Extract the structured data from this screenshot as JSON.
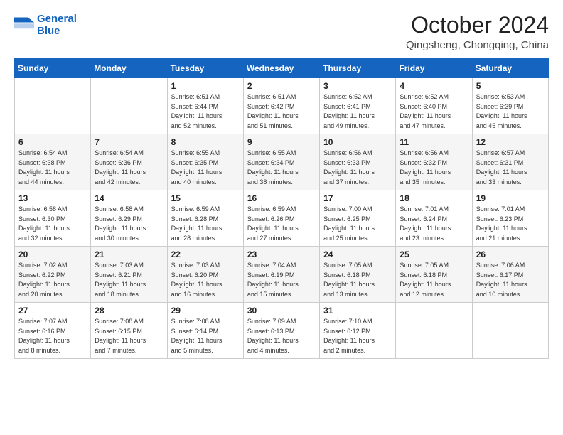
{
  "header": {
    "logo_line1": "General",
    "logo_line2": "Blue",
    "month": "October 2024",
    "location": "Qingsheng, Chongqing, China"
  },
  "weekdays": [
    "Sunday",
    "Monday",
    "Tuesday",
    "Wednesday",
    "Thursday",
    "Friday",
    "Saturday"
  ],
  "weeks": [
    [
      {
        "day": "",
        "info": ""
      },
      {
        "day": "",
        "info": ""
      },
      {
        "day": "1",
        "info": "Sunrise: 6:51 AM\nSunset: 6:44 PM\nDaylight: 11 hours\nand 52 minutes."
      },
      {
        "day": "2",
        "info": "Sunrise: 6:51 AM\nSunset: 6:42 PM\nDaylight: 11 hours\nand 51 minutes."
      },
      {
        "day": "3",
        "info": "Sunrise: 6:52 AM\nSunset: 6:41 PM\nDaylight: 11 hours\nand 49 minutes."
      },
      {
        "day": "4",
        "info": "Sunrise: 6:52 AM\nSunset: 6:40 PM\nDaylight: 11 hours\nand 47 minutes."
      },
      {
        "day": "5",
        "info": "Sunrise: 6:53 AM\nSunset: 6:39 PM\nDaylight: 11 hours\nand 45 minutes."
      }
    ],
    [
      {
        "day": "6",
        "info": "Sunrise: 6:54 AM\nSunset: 6:38 PM\nDaylight: 11 hours\nand 44 minutes."
      },
      {
        "day": "7",
        "info": "Sunrise: 6:54 AM\nSunset: 6:36 PM\nDaylight: 11 hours\nand 42 minutes."
      },
      {
        "day": "8",
        "info": "Sunrise: 6:55 AM\nSunset: 6:35 PM\nDaylight: 11 hours\nand 40 minutes."
      },
      {
        "day": "9",
        "info": "Sunrise: 6:55 AM\nSunset: 6:34 PM\nDaylight: 11 hours\nand 38 minutes."
      },
      {
        "day": "10",
        "info": "Sunrise: 6:56 AM\nSunset: 6:33 PM\nDaylight: 11 hours\nand 37 minutes."
      },
      {
        "day": "11",
        "info": "Sunrise: 6:56 AM\nSunset: 6:32 PM\nDaylight: 11 hours\nand 35 minutes."
      },
      {
        "day": "12",
        "info": "Sunrise: 6:57 AM\nSunset: 6:31 PM\nDaylight: 11 hours\nand 33 minutes."
      }
    ],
    [
      {
        "day": "13",
        "info": "Sunrise: 6:58 AM\nSunset: 6:30 PM\nDaylight: 11 hours\nand 32 minutes."
      },
      {
        "day": "14",
        "info": "Sunrise: 6:58 AM\nSunset: 6:29 PM\nDaylight: 11 hours\nand 30 minutes."
      },
      {
        "day": "15",
        "info": "Sunrise: 6:59 AM\nSunset: 6:28 PM\nDaylight: 11 hours\nand 28 minutes."
      },
      {
        "day": "16",
        "info": "Sunrise: 6:59 AM\nSunset: 6:26 PM\nDaylight: 11 hours\nand 27 minutes."
      },
      {
        "day": "17",
        "info": "Sunrise: 7:00 AM\nSunset: 6:25 PM\nDaylight: 11 hours\nand 25 minutes."
      },
      {
        "day": "18",
        "info": "Sunrise: 7:01 AM\nSunset: 6:24 PM\nDaylight: 11 hours\nand 23 minutes."
      },
      {
        "day": "19",
        "info": "Sunrise: 7:01 AM\nSunset: 6:23 PM\nDaylight: 11 hours\nand 21 minutes."
      }
    ],
    [
      {
        "day": "20",
        "info": "Sunrise: 7:02 AM\nSunset: 6:22 PM\nDaylight: 11 hours\nand 20 minutes."
      },
      {
        "day": "21",
        "info": "Sunrise: 7:03 AM\nSunset: 6:21 PM\nDaylight: 11 hours\nand 18 minutes."
      },
      {
        "day": "22",
        "info": "Sunrise: 7:03 AM\nSunset: 6:20 PM\nDaylight: 11 hours\nand 16 minutes."
      },
      {
        "day": "23",
        "info": "Sunrise: 7:04 AM\nSunset: 6:19 PM\nDaylight: 11 hours\nand 15 minutes."
      },
      {
        "day": "24",
        "info": "Sunrise: 7:05 AM\nSunset: 6:18 PM\nDaylight: 11 hours\nand 13 minutes."
      },
      {
        "day": "25",
        "info": "Sunrise: 7:05 AM\nSunset: 6:18 PM\nDaylight: 11 hours\nand 12 minutes."
      },
      {
        "day": "26",
        "info": "Sunrise: 7:06 AM\nSunset: 6:17 PM\nDaylight: 11 hours\nand 10 minutes."
      }
    ],
    [
      {
        "day": "27",
        "info": "Sunrise: 7:07 AM\nSunset: 6:16 PM\nDaylight: 11 hours\nand 8 minutes."
      },
      {
        "day": "28",
        "info": "Sunrise: 7:08 AM\nSunset: 6:15 PM\nDaylight: 11 hours\nand 7 minutes."
      },
      {
        "day": "29",
        "info": "Sunrise: 7:08 AM\nSunset: 6:14 PM\nDaylight: 11 hours\nand 5 minutes."
      },
      {
        "day": "30",
        "info": "Sunrise: 7:09 AM\nSunset: 6:13 PM\nDaylight: 11 hours\nand 4 minutes."
      },
      {
        "day": "31",
        "info": "Sunrise: 7:10 AM\nSunset: 6:12 PM\nDaylight: 11 hours\nand 2 minutes."
      },
      {
        "day": "",
        "info": ""
      },
      {
        "day": "",
        "info": ""
      }
    ]
  ]
}
